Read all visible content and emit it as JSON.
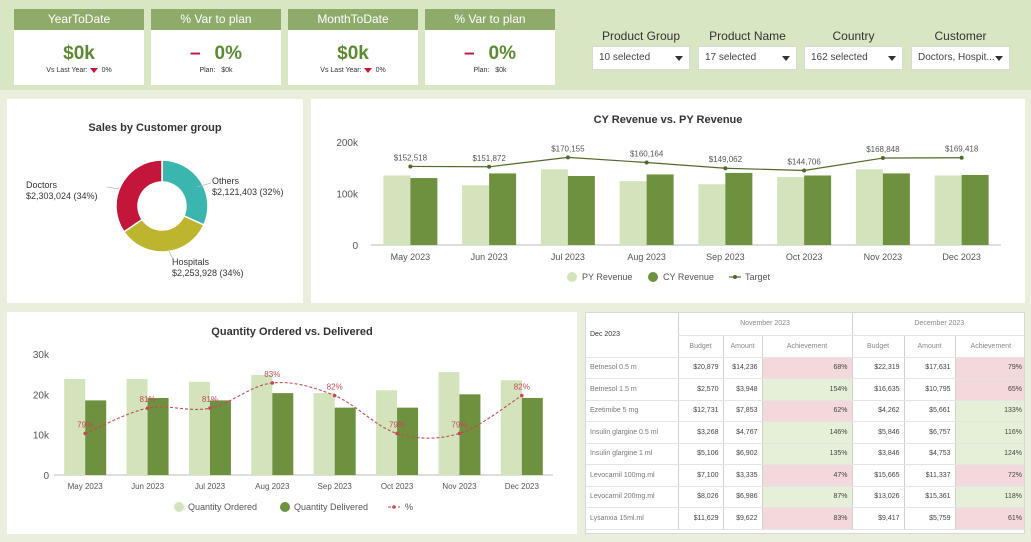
{
  "kpis": [
    {
      "title": "YearToDate",
      "value": "$0k",
      "dash": "",
      "sub_label": "Vs Last Year:",
      "sub_value": "0%",
      "arrow": true
    },
    {
      "title": "% Var to plan",
      "value": "0%",
      "dash": "–",
      "sub_label": "Plan:",
      "sub_value": "$0k",
      "arrow": false
    },
    {
      "title": "MonthToDate",
      "value": "$0k",
      "dash": "",
      "sub_label": "Vs Last Year:",
      "sub_value": "0%",
      "arrow": true
    },
    {
      "title": "% Var to plan",
      "value": "0%",
      "dash": "–",
      "sub_label": "Plan:",
      "sub_value": "$0k",
      "arrow": false
    }
  ],
  "filters": [
    {
      "label": "Product Group",
      "value": "10 selected"
    },
    {
      "label": "Product Name",
      "value": "17 selected"
    },
    {
      "label": "Country",
      "value": "162 selected"
    },
    {
      "label": "Customer",
      "value": "Doctors, Hospit..."
    }
  ],
  "colors": {
    "py": "#d3e3bc",
    "cy": "#6e9140",
    "target": "#4f6b2c",
    "doctors": "#c4153a",
    "others": "#3ab6ae",
    "hospitals": "#bdb52d",
    "pct_line": "#c44a55"
  },
  "chart_data": [
    {
      "type": "pie",
      "title": "Sales by Customer group",
      "slices": [
        {
          "name": "Others",
          "value": 2121403,
          "label": "$2,121,403 (32%)",
          "pct": 32
        },
        {
          "name": "Hospitals",
          "value": 2253928,
          "label": "$2,253,928 (34%)",
          "pct": 34
        },
        {
          "name": "Doctors",
          "value": 2303024,
          "label": "$2,303,024 (34%)",
          "pct": 34
        }
      ]
    },
    {
      "type": "bar",
      "title": "CY Revenue vs. PY Revenue",
      "categories": [
        "May 2023",
        "Jun 2023",
        "Jul 2023",
        "Aug 2023",
        "Sep 2023",
        "Oct 2023",
        "Nov 2023",
        "Dec 2023"
      ],
      "ylim": [
        0,
        200000
      ],
      "yticks": [
        {
          "v": 0,
          "label": "0"
        },
        {
          "v": 100000,
          "label": "100k"
        },
        {
          "v": 200000,
          "label": "200k"
        }
      ],
      "series": [
        {
          "name": "PY Revenue",
          "values": [
            135000,
            116000,
            147000,
            124000,
            118000,
            132000,
            147000,
            135000
          ]
        },
        {
          "name": "CY Revenue",
          "values": [
            130000,
            139000,
            134000,
            137000,
            140000,
            135000,
            139000,
            136000
          ]
        },
        {
          "name": "Target",
          "values": [
            152518,
            151872,
            170155,
            160164,
            149062,
            144706,
            168848,
            169418
          ],
          "labels": [
            "$152,518",
            "$151,872",
            "$170,155",
            "$160,164",
            "$149,062",
            "$144,706",
            "$168,848",
            "$169,418"
          ]
        }
      ]
    },
    {
      "type": "bar",
      "title": "Quantity Ordered vs. Delivered",
      "categories": [
        "May 2023",
        "Jun 2023",
        "Jul 2023",
        "Aug 2023",
        "Sep 2023",
        "Oct 2023",
        "Nov 2023",
        "Dec 2023"
      ],
      "ylim": [
        0,
        30000
      ],
      "yticks": [
        {
          "v": 0,
          "label": "0"
        },
        {
          "v": 10000,
          "label": "10k"
        },
        {
          "v": 20000,
          "label": "20k"
        },
        {
          "v": 30000,
          "label": "30k"
        }
      ],
      "series": [
        {
          "name": "Quantity Ordered",
          "values": [
            23800,
            23800,
            23100,
            24800,
            20300,
            21000,
            25500,
            23500
          ]
        },
        {
          "name": "Quantity Delivered",
          "values": [
            18500,
            19100,
            18500,
            20300,
            16700,
            16700,
            20000,
            19100
          ]
        },
        {
          "name": "%",
          "values": [
            79,
            81,
            81,
            83,
            82,
            79,
            79,
            82
          ],
          "labels": [
            "79%",
            "81%",
            "81%",
            "83%",
            "82%",
            "79%",
            "79%",
            "82%"
          ]
        }
      ]
    },
    {
      "type": "table",
      "selector": "Dec 2023",
      "groups": [
        "November 2023",
        "December 2023"
      ],
      "columns": [
        "Budget",
        "Amount",
        "Achievement",
        "Budget",
        "Amount",
        "Achievement"
      ],
      "rows": [
        {
          "name": "Betnesol 0.5 m",
          "nb": "$20,879",
          "na": "$14,236",
          "nach": "68%",
          "nc": "neg",
          "db": "$22,319",
          "da": "$17,631",
          "dach": "79%",
          "dc": "neg"
        },
        {
          "name": "Betnesol 1.5 m",
          "nb": "$2,570",
          "na": "$3,948",
          "nach": "154%",
          "nc": "pos",
          "db": "$16,635",
          "da": "$10,795",
          "dach": "65%",
          "dc": "neg"
        },
        {
          "name": "Ezetimibe 5 mg",
          "nb": "$12,731",
          "na": "$7,853",
          "nach": "62%",
          "nc": "neg",
          "db": "$4,262",
          "da": "$5,661",
          "dach": "133%",
          "dc": "pos"
        },
        {
          "name": "Insulin glargine 0.5 ml",
          "nb": "$3,268",
          "na": "$4,767",
          "nach": "146%",
          "nc": "pos",
          "db": "$5,846",
          "da": "$6,757",
          "dach": "116%",
          "dc": "pos"
        },
        {
          "name": "Insulin glargine 1 ml",
          "nb": "$5,106",
          "na": "$6,902",
          "nach": "135%",
          "nc": "pos",
          "db": "$3,846",
          "da": "$4,753",
          "dach": "124%",
          "dc": "pos"
        },
        {
          "name": "Levocarnil 100mg.ml",
          "nb": "$7,100",
          "na": "$3,335",
          "nach": "47%",
          "nc": "neg",
          "db": "$15,665",
          "da": "$11,337",
          "dach": "72%",
          "dc": "neg"
        },
        {
          "name": "Levocarnil 200mg.ml",
          "nb": "$8,026",
          "na": "$6,986",
          "nach": "87%",
          "nc": "pos",
          "db": "$13,026",
          "da": "$15,361",
          "dach": "118%",
          "dc": "pos"
        },
        {
          "name": "Lysanxia 15ml.ml",
          "nb": "$11,629",
          "na": "$9,622",
          "nach": "83%",
          "nc": "neg",
          "db": "$9,417",
          "da": "$5,759",
          "dach": "61%",
          "dc": "neg"
        }
      ]
    }
  ]
}
